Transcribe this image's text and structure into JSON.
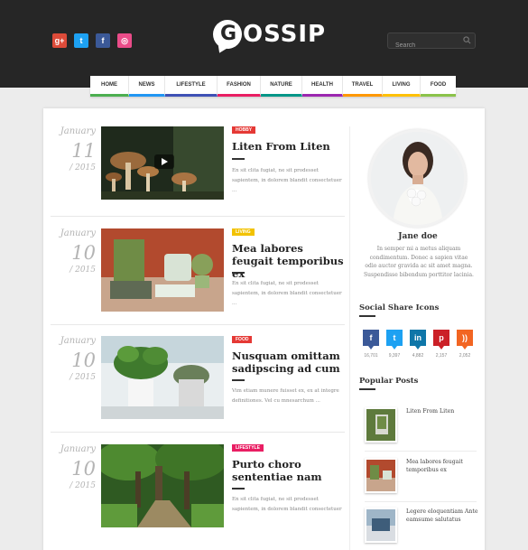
{
  "header": {
    "logo_text": "OSSIP",
    "logo_letter": "G",
    "social": [
      {
        "name": "google-plus-icon",
        "glyph": "g+",
        "color": "#dd4b39"
      },
      {
        "name": "twitter-icon",
        "glyph": "t",
        "color": "#1da1f2"
      },
      {
        "name": "facebook-icon",
        "glyph": "f",
        "color": "#3b5998"
      },
      {
        "name": "dribbble-icon",
        "glyph": "◎",
        "color": "#ea4c89"
      }
    ],
    "search_placeholder": "Search"
  },
  "nav": [
    {
      "label": "HOME",
      "color": "#4caf50"
    },
    {
      "label": "NEWS",
      "color": "#2196f3"
    },
    {
      "label": "LIFESTYLE",
      "color": "#3f51b5"
    },
    {
      "label": "FASHION",
      "color": "#e91e63"
    },
    {
      "label": "NATURE",
      "color": "#009688"
    },
    {
      "label": "HEALTH",
      "color": "#9c27b0"
    },
    {
      "label": "TRAVEL",
      "color": "#ff9800"
    },
    {
      "label": "LIVING",
      "color": "#ffc107"
    },
    {
      "label": "FOOD",
      "color": "#8bc34a"
    }
  ],
  "posts": [
    {
      "month": "January",
      "day": "11",
      "year": "2015",
      "tag": "HOBBY",
      "tag_color": "#e53935",
      "title": "Liten From Liten",
      "excerpt": "En sit clita fugiat, ne sit prodesset sapientem, in dolorem blandit consectetuer ..."
    },
    {
      "month": "January",
      "day": "10",
      "year": "2015",
      "tag": "LIVING",
      "tag_color": "#f2c200",
      "title": "Mea labores feugait temporibus ex",
      "excerpt": "En sit clita fugiat, ne sit prodesset sapientem, in dolorem blandit consectetuer ..."
    },
    {
      "month": "January",
      "day": "10",
      "year": "2015",
      "tag": "FOOD",
      "tag_color": "#e53935",
      "title": "Nusquam omittam sadipscing ad cum",
      "excerpt": "Vim etiam munere fuisset ex, ex at integre definitiones. Vel cu mnesarchum ..."
    },
    {
      "month": "January",
      "day": "10",
      "year": "2015",
      "tag": "LIFESTYLE",
      "tag_color": "#e91e63",
      "title": "Purto choro sententiae nam",
      "excerpt": "En sit clita fugiat, ne sit prodesset sapientem, in dolorem blandit consectetuer"
    }
  ],
  "sidebar": {
    "author_name": "Jane doe",
    "author_bio": "In semper mi a metus aliquam condimentum. Donec a sapien vitae odio auctor gravida ac sit amet magna. Suspendisse bibendum porttitor lacinia.",
    "share_heading": "Social Share Icons",
    "shares": [
      {
        "name": "facebook-share-icon",
        "glyph": "f",
        "color": "#3b5998",
        "count": "16,701"
      },
      {
        "name": "twitter-share-icon",
        "glyph": "t",
        "color": "#1da1f2",
        "count": "9,397"
      },
      {
        "name": "linkedin-share-icon",
        "glyph": "in",
        "color": "#0e76a8",
        "count": "4,882"
      },
      {
        "name": "pinterest-share-icon",
        "glyph": "p",
        "color": "#cb2027",
        "count": "2,157"
      },
      {
        "name": "rss-share-icon",
        "glyph": "))",
        "color": "#f26522",
        "count": "2,052"
      }
    ],
    "popular_heading": "Popular Posts",
    "popular": [
      {
        "title": "Liten From Liten"
      },
      {
        "title": "Mea labores feugait temporibus ex"
      },
      {
        "title": "Legere eloquentiam Ante eamsume salutatus"
      }
    ]
  }
}
